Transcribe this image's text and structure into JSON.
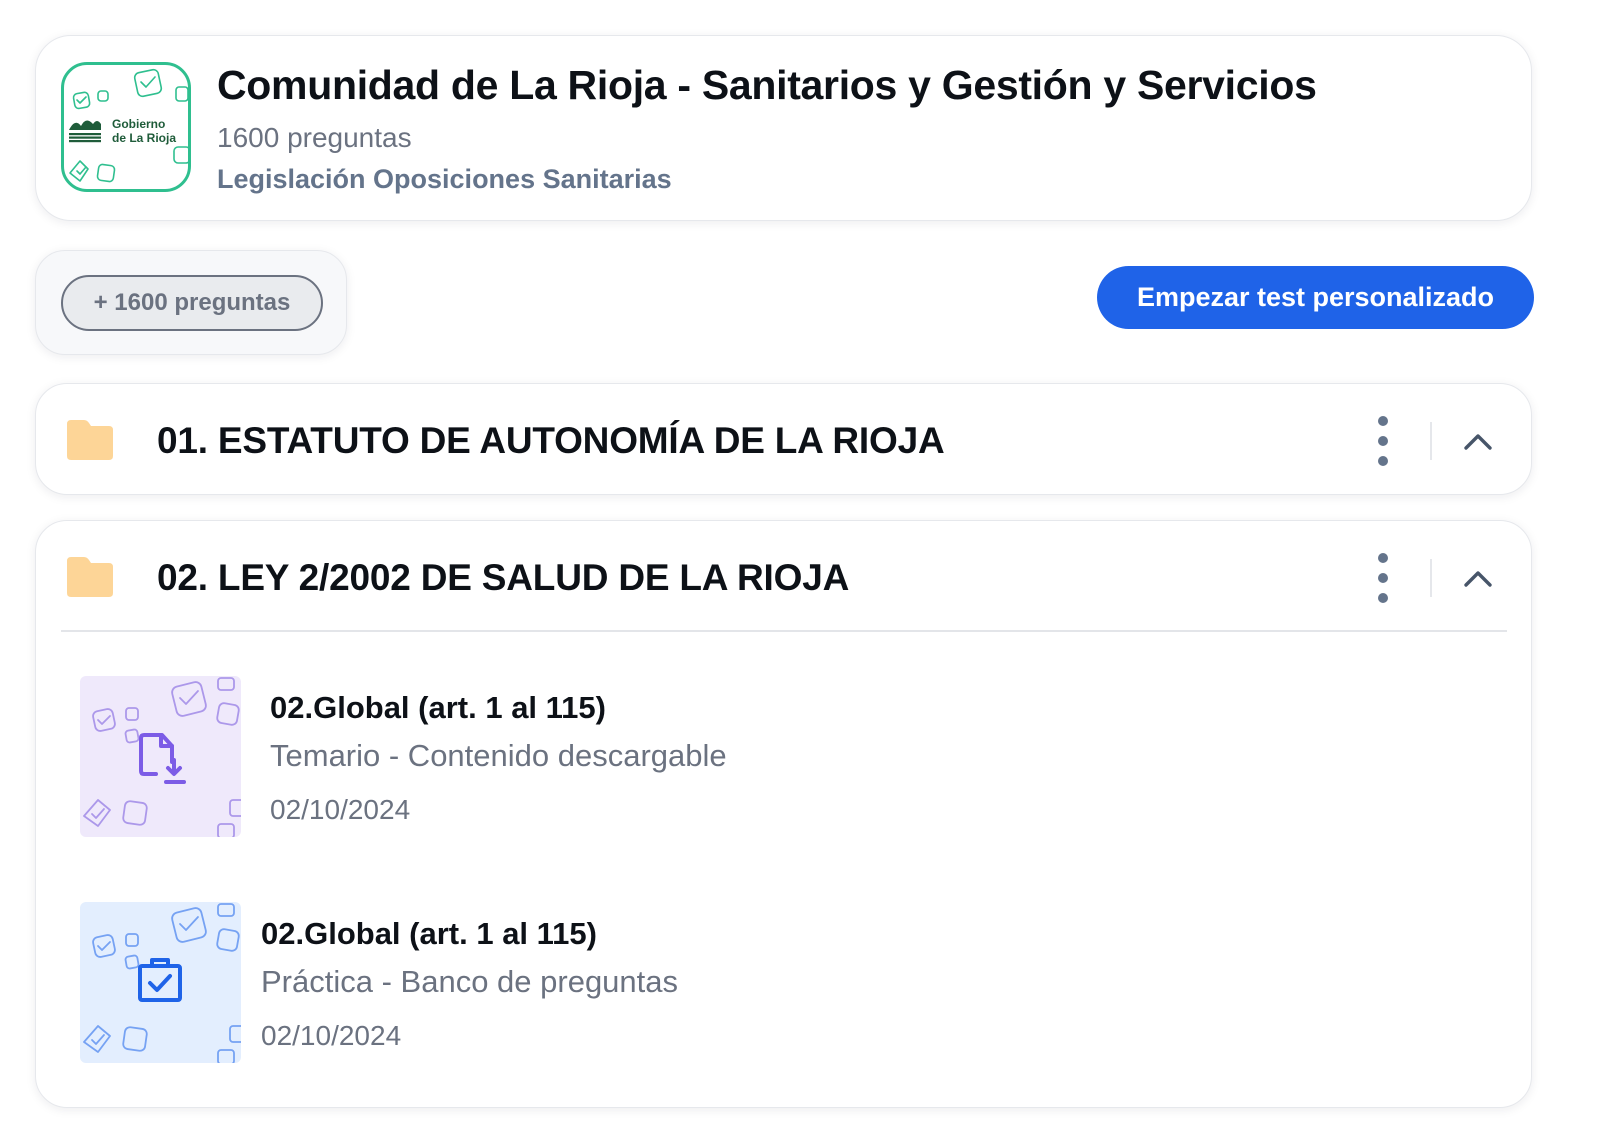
{
  "header": {
    "title": "Comunidad de La Rioja - Sanitarios y Gestión y Servicios",
    "question_count": "1600 preguntas",
    "category": "Legislación Oposiciones Sanitarias",
    "logo": {
      "line1": "Gobierno",
      "line2": "de La Rioja",
      "accent": "#2fbf8f",
      "brand": "#1f5c3a"
    }
  },
  "filter": {
    "chip_label": "+ 1600 preguntas"
  },
  "actions": {
    "start_label": "Empezar test personalizado",
    "accent": "#1f63e8"
  },
  "sections": [
    {
      "title": "01. ESTATUTO DE AUTONOMÍA DE LA RIOJA",
      "icon": "folder-icon",
      "expanded": false
    },
    {
      "title": "02. LEY 2/2002 DE SALUD DE LA RIOJA",
      "icon": "folder-icon",
      "expanded": true,
      "items": [
        {
          "title": "02.Global (art. 1 al 115)",
          "subtitle": "Temario - Contenido descargable",
          "date": "02/10/2024",
          "icon": "file-download-icon",
          "color": "#7c5ce6"
        },
        {
          "title": "02.Global (art. 1 al 115)",
          "subtitle": "Práctica - Banco de preguntas",
          "date": "02/10/2024",
          "icon": "clipboard-check-icon",
          "color": "#1f63e8"
        }
      ]
    }
  ]
}
